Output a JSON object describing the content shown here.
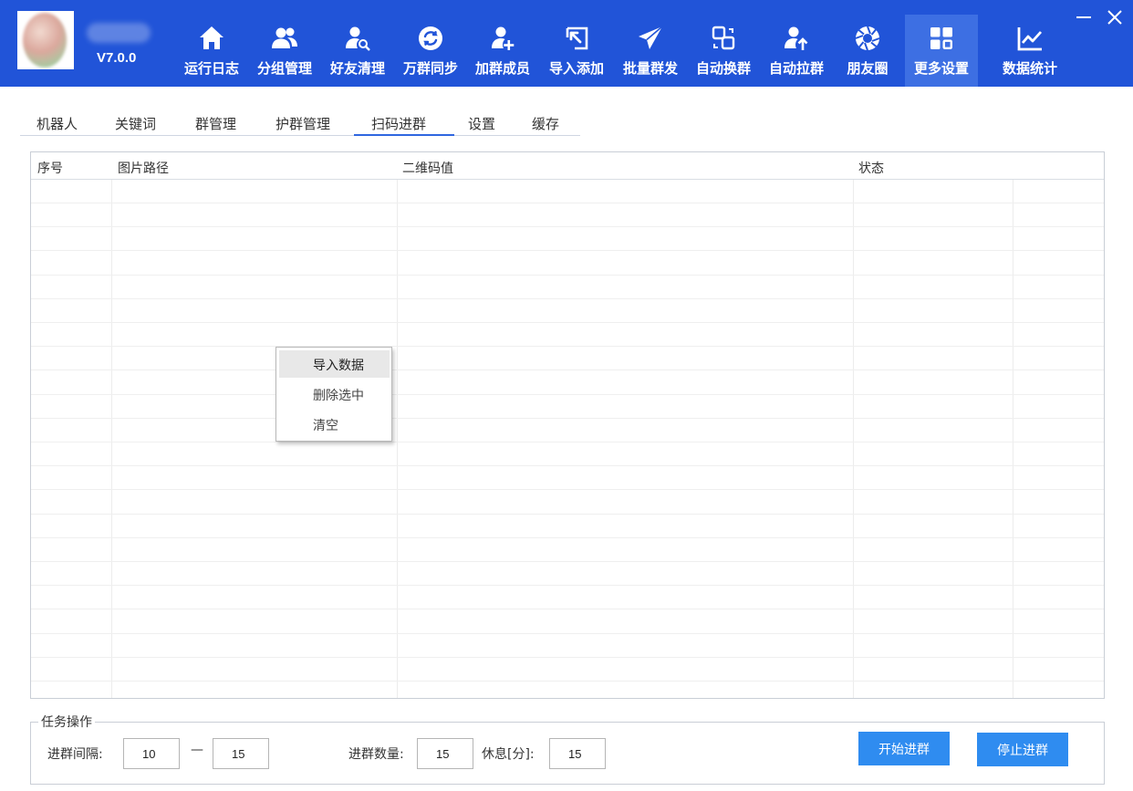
{
  "header": {
    "version": "V7.0.0",
    "nav": [
      {
        "label": "运行日志",
        "icon": "home-icon"
      },
      {
        "label": "分组管理",
        "icon": "users-icon"
      },
      {
        "label": "好友清理",
        "icon": "user-search-icon"
      },
      {
        "label": "万群同步",
        "icon": "sync-icon"
      },
      {
        "label": "加群成员",
        "icon": "user-add-icon"
      },
      {
        "label": "导入添加",
        "icon": "import-icon"
      },
      {
        "label": "批量群发",
        "icon": "send-icon"
      },
      {
        "label": "自动换群",
        "icon": "swap-icon"
      },
      {
        "label": "自动拉群",
        "icon": "user-up-icon"
      },
      {
        "label": "朋友圈",
        "icon": "aperture-icon"
      },
      {
        "label": "更多设置",
        "icon": "grid-icon",
        "active": true
      },
      {
        "label": "数据统计",
        "icon": "chart-icon"
      }
    ]
  },
  "tabs": [
    {
      "label": "机器人"
    },
    {
      "label": "关键词"
    },
    {
      "label": "群管理"
    },
    {
      "label": "护群管理"
    },
    {
      "label": "扫码进群",
      "active": true
    },
    {
      "label": "设置"
    },
    {
      "label": "缓存"
    }
  ],
  "table": {
    "columns": [
      "序号",
      "图片路径",
      "二维码值",
      "状态"
    ],
    "rows": []
  },
  "context_menu": {
    "items": [
      "导入数据",
      "删除选中",
      "清空"
    ],
    "hovered": "导入数据"
  },
  "task": {
    "legend": "任务操作",
    "interval_label": "进群间隔:",
    "interval_min": "10",
    "dash": "—",
    "interval_max": "15",
    "count_label": "进群数量:",
    "count": "15",
    "rest_label": "休息[分]:",
    "rest": "15",
    "start_label": "开始进群",
    "stop_label": "停止进群"
  },
  "colors": {
    "header_bg": "#2154d8",
    "active_nav_bg": "#3d6fe3",
    "button": "#2f8cf0",
    "tab_underline": "#2f66e0"
  }
}
